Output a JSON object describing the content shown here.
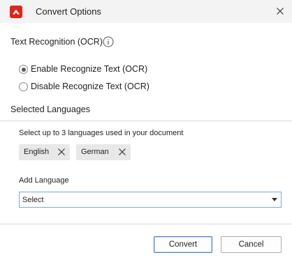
{
  "window": {
    "title": "Convert Options",
    "app_icon": "app-logo-icon",
    "close_icon": "close-icon"
  },
  "ocr": {
    "label": "Text Recognition (OCR)",
    "info_icon": "info-icon",
    "options": [
      {
        "label": "Enable Recognize Text (OCR)",
        "selected": true
      },
      {
        "label": "Disable Recognize Text (OCR)",
        "selected": false
      }
    ]
  },
  "languages": {
    "label": "Selected Languages",
    "hint": "Select up to 3 languages used in your document",
    "selected": [
      {
        "label": "English",
        "remove_icon": "close-icon"
      },
      {
        "label": "German",
        "remove_icon": "close-icon"
      }
    ],
    "add_label": "Add Language",
    "select_value": "Select"
  },
  "footer": {
    "convert_label": "Convert",
    "cancel_label": "Cancel"
  },
  "colors": {
    "brand": "#e2231a",
    "select_border": "#7aa7d6",
    "primary_border": "#4a7fc4"
  }
}
